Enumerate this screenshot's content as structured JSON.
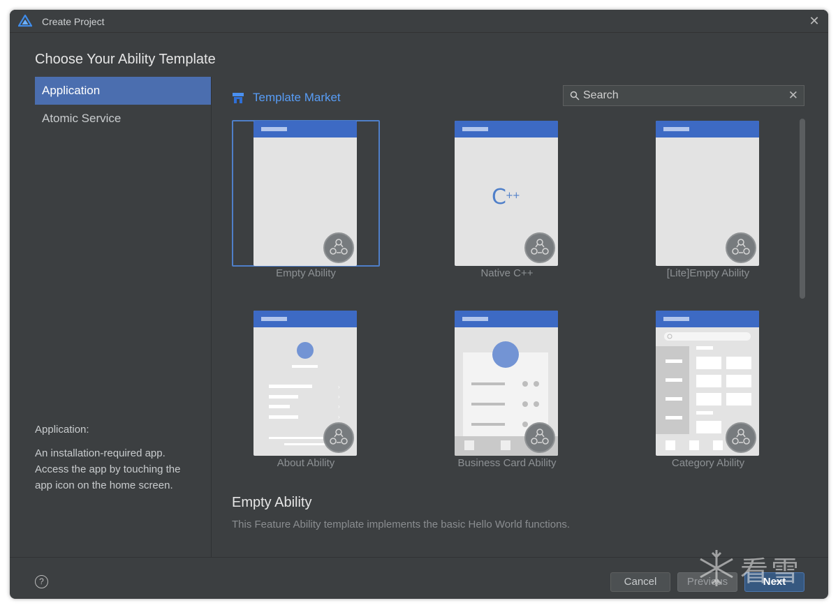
{
  "window": {
    "title": "Create Project"
  },
  "heading": "Choose Your Ability Template",
  "sidebar": {
    "items": [
      {
        "label": "Application",
        "active": true
      },
      {
        "label": "Atomic Service",
        "active": false
      }
    ],
    "description": {
      "title": "Application:",
      "text": "An installation-required app. Access the app by touching the app icon on the home screen."
    }
  },
  "market": {
    "label": "Template Market",
    "icon": "store-icon"
  },
  "search": {
    "placeholder": "Search",
    "value": ""
  },
  "templates": [
    {
      "label": "Empty Ability",
      "selected": true
    },
    {
      "label": "Native C++",
      "selected": false,
      "glyph": "C++"
    },
    {
      "label": "[Lite]Empty Ability",
      "selected": false
    },
    {
      "label": "About Ability",
      "selected": false
    },
    {
      "label": "Business Card Ability",
      "selected": false
    },
    {
      "label": "Category Ability",
      "selected": false
    }
  ],
  "detail": {
    "title": "Empty Ability",
    "text": "This Feature Ability template implements the basic Hello World functions."
  },
  "footer": {
    "help_label": "?",
    "cancel_label": "Cancel",
    "previous_label": "Previous",
    "next_label": "Next"
  },
  "watermark": {
    "text": "看雪"
  },
  "colors": {
    "accent": "#4b6eaf",
    "link": "#589df6",
    "template_bar": "#3d6ac4",
    "background": "#3c3f41"
  }
}
